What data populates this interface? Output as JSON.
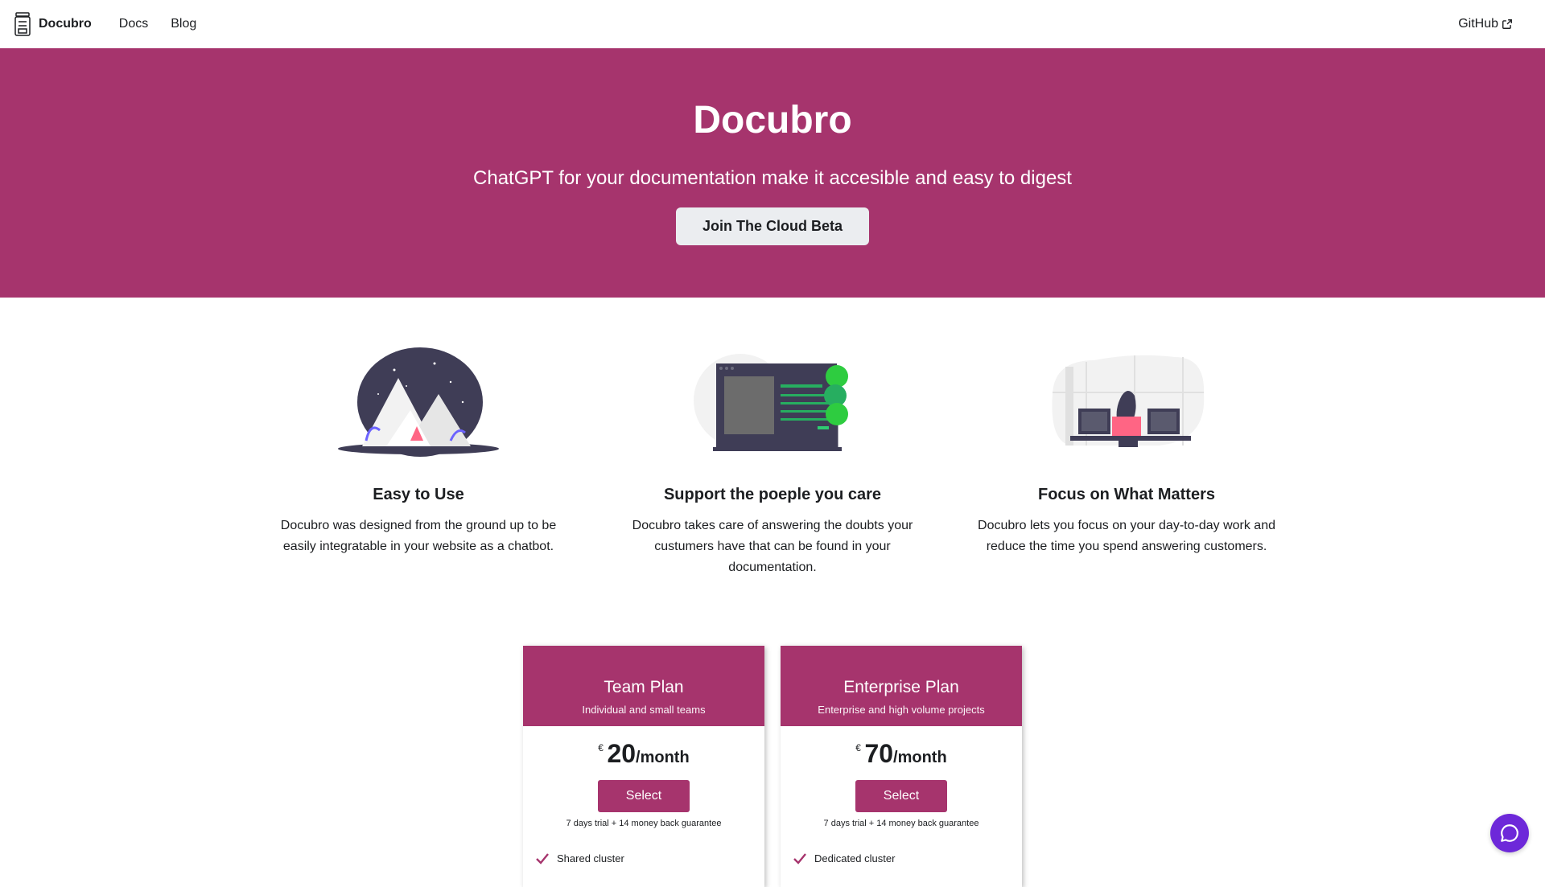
{
  "navbar": {
    "brand": "Docubro",
    "links": [
      "Docs",
      "Blog"
    ],
    "github": "GitHub"
  },
  "hero": {
    "title": "Docubro",
    "subtitle": "ChatGPT for your documentation make it accesible and easy to digest",
    "cta": "Join The Cloud Beta",
    "background": "#a6346d"
  },
  "features": [
    {
      "title": "Easy to Use",
      "description": "Docubro was designed from the ground up to be easily integratable in your website as a chatbot.",
      "illustration": "mountains-illustration"
    },
    {
      "title": "Support the poeple you care",
      "description": "Docubro takes care of answering the doubts your custumers have that can be found in your documentation.",
      "illustration": "browser-tree-illustration"
    },
    {
      "title": "Focus on What Matters",
      "description": "Docubro lets you focus on your day-to-day work and reduce the time you spend answering customers.",
      "illustration": "desk-illustration"
    }
  ],
  "plans": [
    {
      "name": "Team Plan",
      "tagline": "Individual and small teams",
      "currency": "€",
      "amount": "20",
      "period": "/month",
      "button": "Select",
      "guarantee": "7 days trial + 14 money back guarantee",
      "feature": "Shared cluster"
    },
    {
      "name": "Enterprise Plan",
      "tagline": "Enterprise and high volume projects",
      "currency": "€",
      "amount": "70",
      "period": "/month",
      "button": "Select",
      "guarantee": "7 days trial + 14 money back guarantee",
      "feature": "Dedicated cluster"
    }
  ],
  "colors": {
    "accent": "#a6346d",
    "chat": "#6d28d9"
  }
}
